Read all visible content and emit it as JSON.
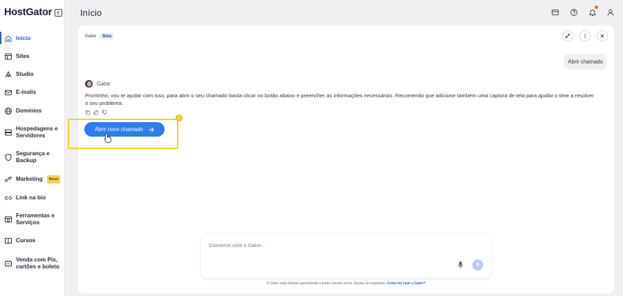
{
  "brand": {
    "name": "HostGator"
  },
  "topbar": {
    "title": "Início"
  },
  "sidebar": {
    "items": [
      {
        "label_lines": [
          "Início"
        ],
        "icon": "home-icon",
        "active": true
      },
      {
        "label_lines": [
          "Sites"
        ],
        "icon": "browser-icon"
      },
      {
        "label_lines": [
          "Studio"
        ],
        "icon": "studio-icon"
      },
      {
        "label_lines": [
          "E-mails"
        ],
        "icon": "mail-icon"
      },
      {
        "label_lines": [
          "Domínios"
        ],
        "icon": "globe-icon"
      },
      {
        "label_lines": [
          "Hospedagens e",
          "Servidores"
        ],
        "icon": "server-icon"
      },
      {
        "label_lines": [
          "Segurança e",
          "Backup"
        ],
        "icon": "shield-icon"
      },
      {
        "label_lines": [
          "Marketing"
        ],
        "icon": "marketing-icon",
        "badge": "Novo"
      },
      {
        "label_lines": [
          "Link na bio"
        ],
        "icon": "link-icon"
      },
      {
        "label_lines": [
          "Ferramentas e",
          "Serviços"
        ],
        "icon": "tools-icon"
      },
      {
        "label_lines": [
          "Cursos"
        ],
        "icon": "book-icon"
      },
      {
        "label_lines": [
          "Venda com Pix,",
          "cartões e boleto"
        ],
        "icon": "payment-icon"
      }
    ]
  },
  "chat": {
    "assistant_name": "Gator",
    "beta_label": "Beta",
    "user_message": "Abrir chamado",
    "bot_name": "Gator",
    "bot_message": "Prontinho, vou te ajudar com isso, para abrir o seu chamado basta clicar no botão abaixo e preencher as informações necessárias. Recomendo que adicione também uma captura de tela para ajudar o time a resolver o seu problema.",
    "action_button": "Abrir novo chamado",
    "step_number": "2",
    "input_placeholder": "Converse com o Gator...",
    "disclaimer": "O Gator está sempre aprendendo e pode cometer erros. Revise as respostas.",
    "disclaimer_link": "Como foi usar o Gator?"
  },
  "colors": {
    "accent": "#2e7dea",
    "highlight": "#f0d326",
    "active_nav": "#2e5dd8"
  }
}
